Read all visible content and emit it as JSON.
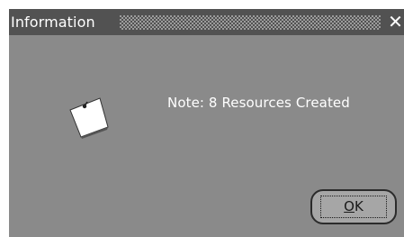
{
  "dialog": {
    "title": "Information",
    "close_glyph": "✕",
    "icon": "note-icon",
    "message": "Note: 8 Resources Created",
    "ok_mnemonic": "O",
    "ok_rest": "K"
  },
  "colors": {
    "titlebar": "#525252",
    "body": "#8a8a8a",
    "text": "#ffffff",
    "button": "#a6a6a6"
  }
}
